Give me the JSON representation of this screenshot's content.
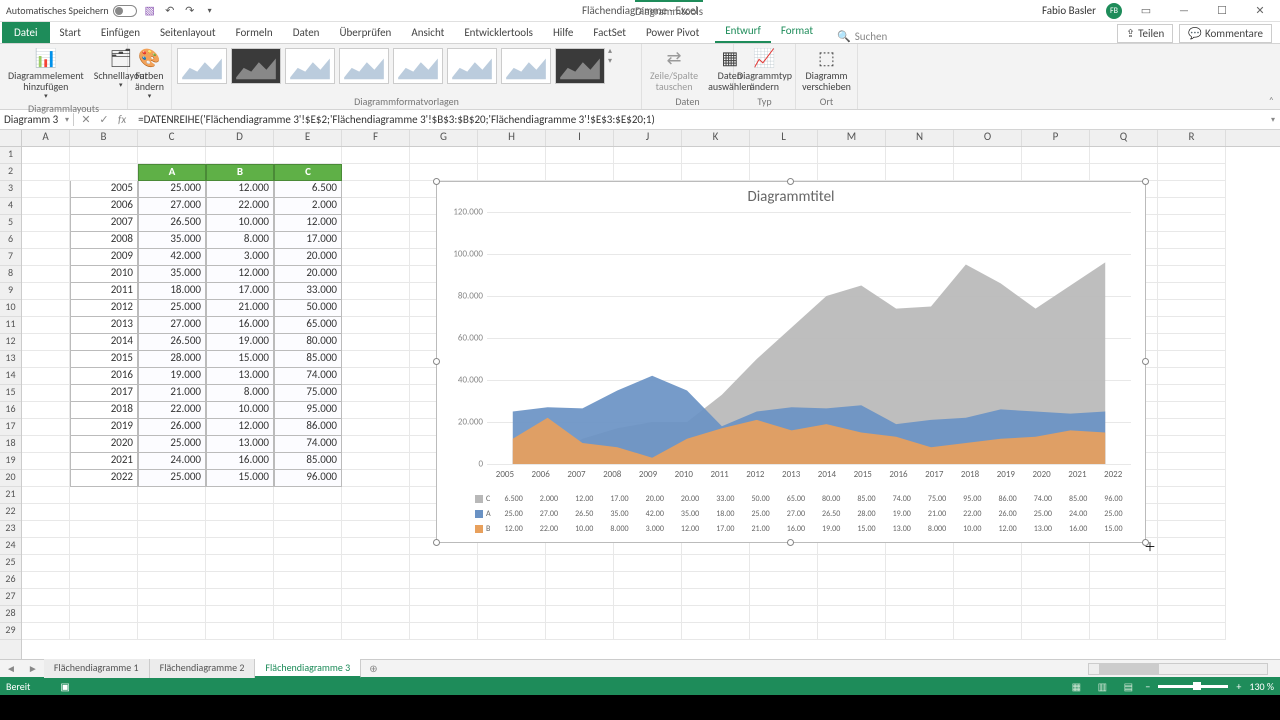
{
  "titlebar": {
    "auto_save": "Automatisches Speichern",
    "doc_title": "Flächendiagramme - Excel",
    "chart_tools": "Diagrammtools",
    "user": "Fabio Basler",
    "initials": "FB"
  },
  "tabs": {
    "file": "Datei",
    "list": [
      "Start",
      "Einfügen",
      "Seitenlayout",
      "Formeln",
      "Daten",
      "Überprüfen",
      "Ansicht",
      "Entwicklertools",
      "Hilfe",
      "FactSet",
      "Power Pivot"
    ],
    "tools": [
      "Entwurf",
      "Format"
    ],
    "active": "Entwurf",
    "search_placeholder": "Suchen",
    "share": "Teilen",
    "comments": "Kommentare"
  },
  "ribbon": {
    "layouts_group": "Diagrammlayouts",
    "add_element": "Diagrammelement hinzufügen",
    "quick_layout": "Schnelllayout",
    "colors": "Farben ändern",
    "styles_group": "Diagrammformatvorlagen",
    "switch_rc": "Zeile/Spalte tauschen",
    "select_data": "Daten auswählen",
    "data_group": "Daten",
    "change_type": "Diagrammtyp ändern",
    "type_group": "Typ",
    "move_chart": "Diagramm verschieben",
    "loc_group": "Ort"
  },
  "namebox": "Diagramm 3",
  "formula": "=DATENREIHE('Flächendiagramme 3'!$E$2;'Flächendiagramme 3'!$B$3:$B$20;'Flächendiagramme 3'!$E$3:$E$20;1)",
  "columns": [
    "A",
    "B",
    "C",
    "D",
    "E",
    "F",
    "G",
    "H",
    "I",
    "J",
    "K",
    "L",
    "M",
    "N",
    "O",
    "P",
    "Q",
    "R"
  ],
  "series_headers": [
    "A",
    "B",
    "C"
  ],
  "years": [
    "2005",
    "2006",
    "2007",
    "2008",
    "2009",
    "2010",
    "2011",
    "2012",
    "2013",
    "2014",
    "2015",
    "2016",
    "2017",
    "2018",
    "2019",
    "2020",
    "2021",
    "2022"
  ],
  "col_A": [
    "25.000",
    "27.000",
    "26.500",
    "35.000",
    "42.000",
    "35.000",
    "18.000",
    "25.000",
    "27.000",
    "26.500",
    "28.000",
    "19.000",
    "21.000",
    "22.000",
    "26.000",
    "25.000",
    "24.000",
    "25.000"
  ],
  "col_B": [
    "12.000",
    "22.000",
    "10.000",
    "8.000",
    "3.000",
    "12.000",
    "17.000",
    "21.000",
    "16.000",
    "19.000",
    "15.000",
    "13.000",
    "8.000",
    "10.000",
    "12.000",
    "13.000",
    "16.000",
    "15.000"
  ],
  "col_C": [
    "6.500",
    "2.000",
    "12.000",
    "17.000",
    "20.000",
    "20.000",
    "33.000",
    "50.000",
    "65.000",
    "80.000",
    "85.000",
    "74.000",
    "75.000",
    "95.000",
    "86.000",
    "74.000",
    "85.000",
    "96.000"
  ],
  "chart_data": {
    "type": "area",
    "title": "Diagrammtitel",
    "categories": [
      "2005",
      "2006",
      "2007",
      "2008",
      "2009",
      "2010",
      "2011",
      "2012",
      "2013",
      "2014",
      "2015",
      "2016",
      "2017",
      "2018",
      "2019",
      "2020",
      "2021",
      "2022"
    ],
    "series": [
      {
        "name": "C",
        "values": [
          6500,
          2000,
          12000,
          17000,
          20000,
          20000,
          33000,
          50000,
          65000,
          80000,
          85000,
          74000,
          75000,
          95000,
          86000,
          74000,
          85000,
          96000
        ],
        "color": "#b8b8b8"
      },
      {
        "name": "A",
        "values": [
          25000,
          27000,
          26500,
          35000,
          42000,
          35000,
          18000,
          25000,
          27000,
          26500,
          28000,
          19000,
          21000,
          22000,
          26000,
          25000,
          24000,
          25000
        ],
        "color": "#6a92c4"
      },
      {
        "name": "B",
        "values": [
          12000,
          22000,
          10000,
          8000,
          3000,
          12000,
          17000,
          21000,
          16000,
          19000,
          15000,
          13000,
          8000,
          10000,
          12000,
          13000,
          16000,
          15000
        ],
        "color": "#e8a05c"
      }
    ],
    "ylim": [
      0,
      120000
    ],
    "yticks": [
      0,
      20000,
      40000,
      60000,
      80000,
      100000,
      120000
    ],
    "ytick_labels": [
      "0",
      "20.000",
      "40.000",
      "60.000",
      "80.000",
      "100.000",
      "120.000"
    ],
    "data_table": [
      {
        "name": "C",
        "vals": [
          "6.500",
          "2.000",
          "12.00",
          "17.00",
          "20.00",
          "20.00",
          "33.00",
          "50.00",
          "65.00",
          "80.00",
          "85.00",
          "74.00",
          "75.00",
          "95.00",
          "86.00",
          "74.00",
          "85.00",
          "96.00"
        ]
      },
      {
        "name": "A",
        "vals": [
          "25.00",
          "27.00",
          "26.50",
          "35.00",
          "42.00",
          "35.00",
          "18.00",
          "25.00",
          "27.00",
          "26.50",
          "28.00",
          "19.00",
          "21.00",
          "22.00",
          "26.00",
          "25.00",
          "24.00",
          "25.00"
        ]
      },
      {
        "name": "B",
        "vals": [
          "12.00",
          "22.00",
          "10.00",
          "8.000",
          "3.000",
          "12.00",
          "17.00",
          "21.00",
          "16.00",
          "19.00",
          "15.00",
          "13.00",
          "8.000",
          "10.00",
          "12.00",
          "13.00",
          "16.00",
          "15.00"
        ]
      }
    ]
  },
  "sheets": [
    "Flächendiagramme 1",
    "Flächendiagramme 2",
    "Flächendiagramme 3"
  ],
  "active_sheet": 2,
  "status": {
    "ready": "Bereit",
    "zoom": "130 %"
  }
}
